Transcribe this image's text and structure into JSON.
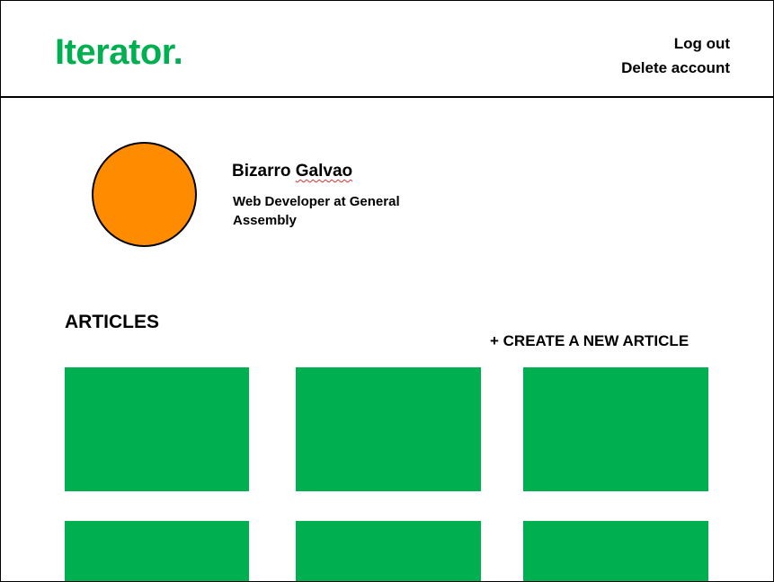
{
  "brand": {
    "logo": "Iterator.",
    "color": "#00b050"
  },
  "header": {
    "links": [
      "Log out",
      "Delete account"
    ]
  },
  "profile": {
    "first_name": "Bizarro",
    "last_name": "Galvao",
    "title": "Web Developer at General Assembly",
    "avatar_color": "#ff8c00"
  },
  "articles": {
    "heading": "ARTICLES",
    "create_label": "+ CREATE A NEW ARTICLE",
    "card_color": "#00b050",
    "card_count_visible": 6
  }
}
